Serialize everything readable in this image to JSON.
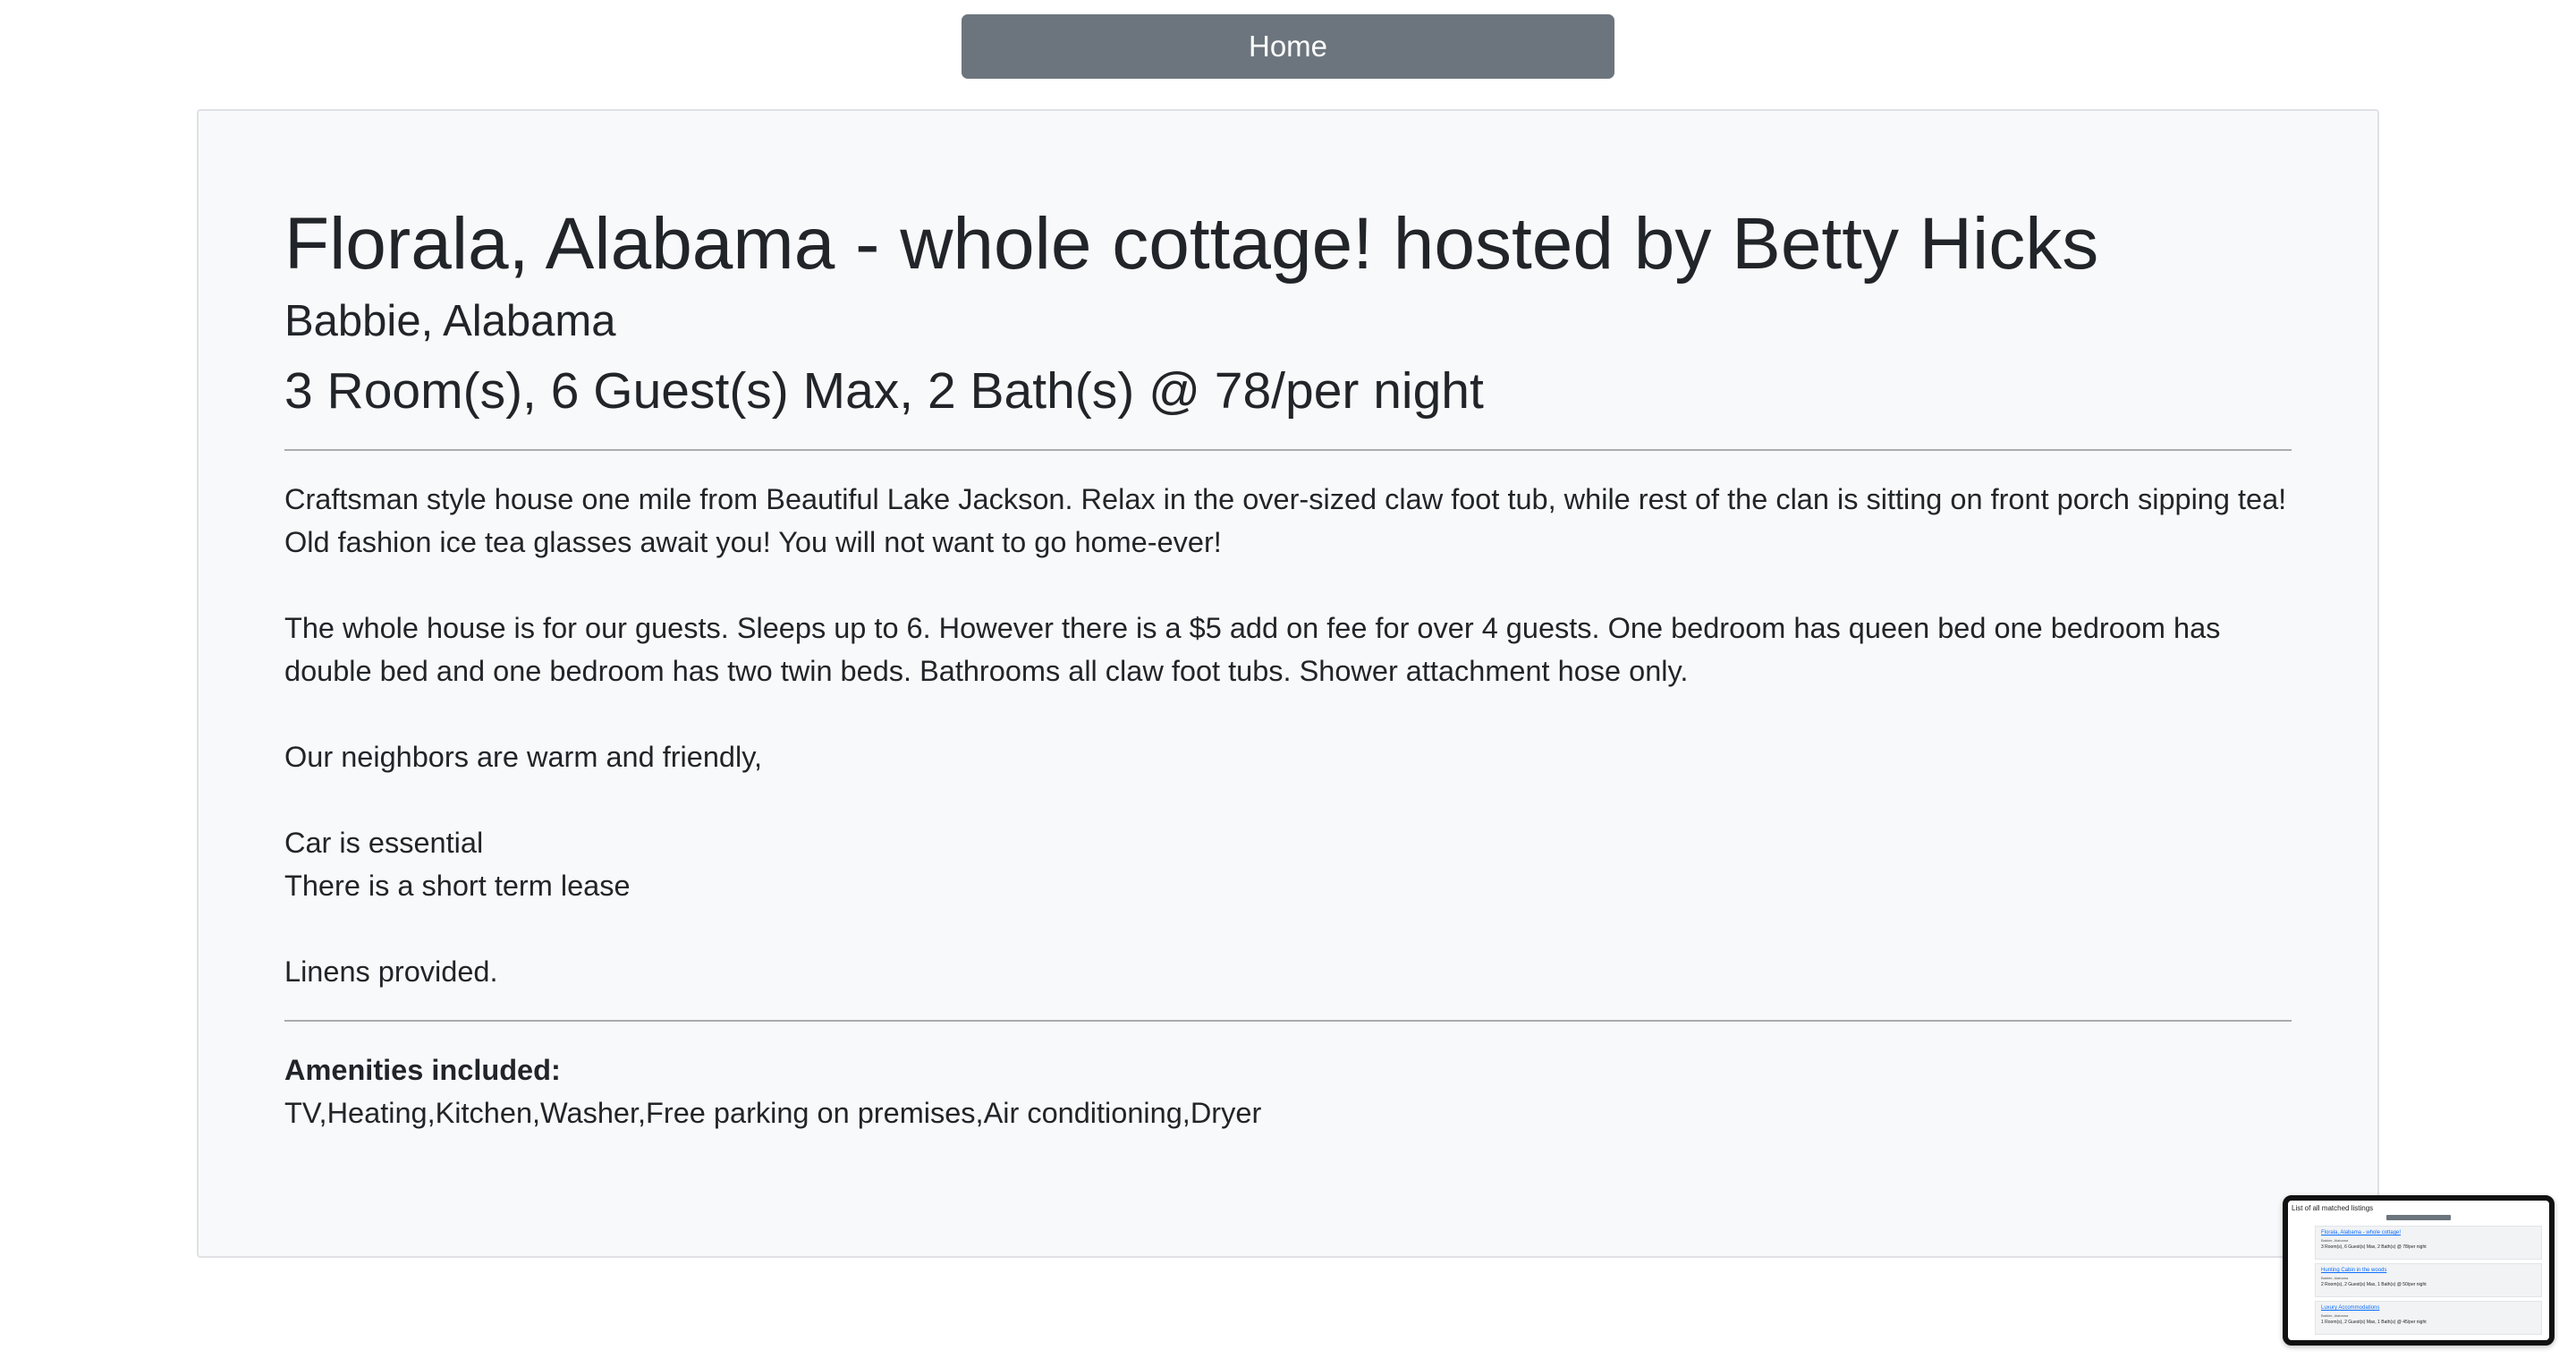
{
  "nav": {
    "home_label": "Home"
  },
  "listing": {
    "title": "Florala, Alabama - whole cottage! hosted by Betty Hicks",
    "location": "Babbie, Alabama",
    "specs": "3 Room(s), 6 Guest(s) Max, 2 Bath(s) @ 78/per night",
    "description": [
      "Craftsman style house one mile from Beautiful Lake Jackson. Relax in the over-sized claw foot tub, while rest of the clan is sitting on front porch sipping tea! Old fashion ice tea glasses await you! You will not want to go home-ever!",
      "The whole house is for our guests. Sleeps up to 6. However there is a $5 add on fee for over 4 guests. One bedroom has queen bed one bedroom has double bed and one bedroom has two twin beds. Bathrooms all claw foot tubs. Shower attachment hose only.",
      "Our neighbors are warm and friendly,",
      "Car is essential",
      "There is a short term lease",
      "Linens provided."
    ],
    "amenities_heading": "Amenities included:",
    "amenities": "TV,Heating,Kitchen,Washer,Free parking on premises,Air conditioning,Dryer"
  },
  "thumbnail": {
    "heading": "List of all matched listings",
    "items": [
      {
        "title": "Florala, Alabama - whole cottage!",
        "location": "Babbie, Alabama",
        "specs": "3 Room(s), 6 Guest(s) Max, 2 Bath(s) @ 78/per night"
      },
      {
        "title": "Hunting Cabin in the woods",
        "location": "Babbie, Alabama",
        "specs": "2 Room(s), 2 Guest(s) Max, 1 Bath(s) @ 50/per night"
      },
      {
        "title": "Luxury Accommodations",
        "location": "Babbie, Alabama",
        "specs": "1 Room(s), 2 Guest(s) Max, 1 Bath(s) @ 45/per night"
      }
    ]
  },
  "colors": {
    "button_bg": "#6c757d",
    "card_bg": "#f8f9fa",
    "text": "#212529",
    "link": "#0d6efd"
  }
}
